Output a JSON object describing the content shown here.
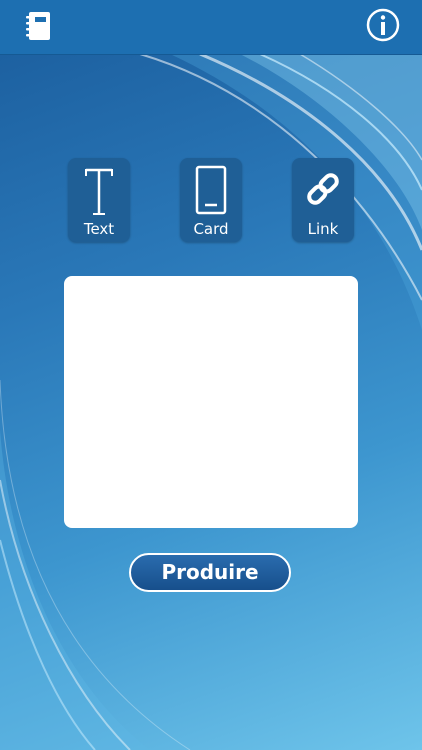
{
  "header": {
    "left_icon": "notebook-icon",
    "right_icon": "info-icon"
  },
  "modes": [
    {
      "label": "Text",
      "icon": "text-t-icon"
    },
    {
      "label": "Card",
      "icon": "card-icon"
    },
    {
      "label": "Link",
      "icon": "link-icon"
    }
  ],
  "actions": {
    "produce_label": "Produire"
  },
  "colors": {
    "topbar": "#1d6fb1",
    "mode_button": "#1f5f96",
    "produce_button": "#1d5d9e",
    "preview_background": "#ffffff"
  }
}
